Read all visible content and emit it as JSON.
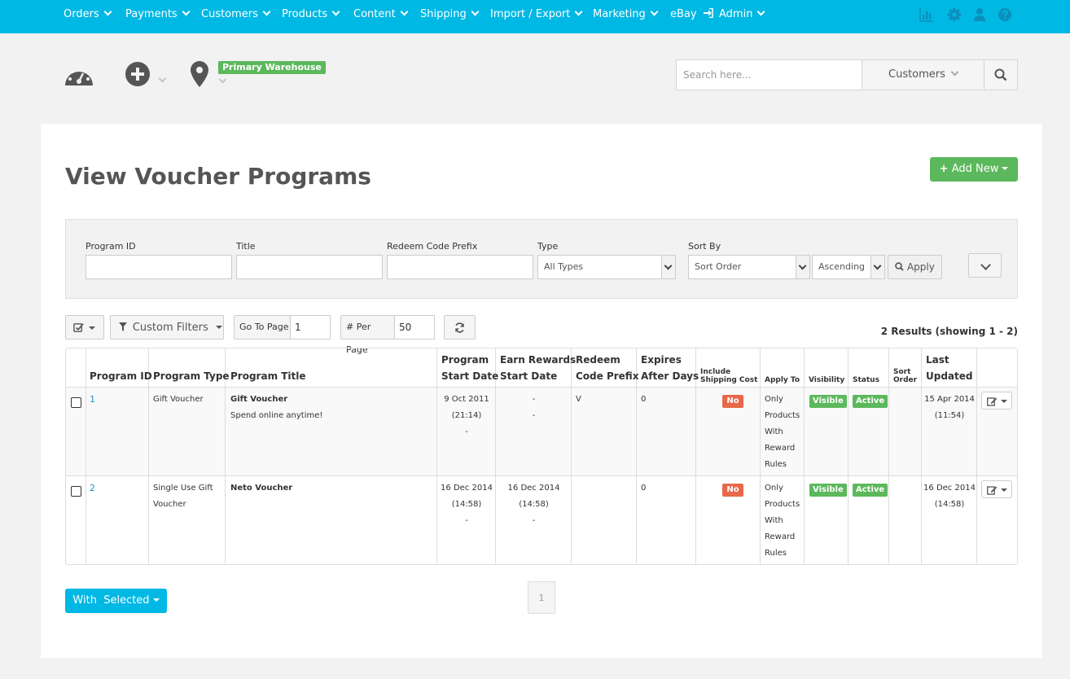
{
  "nav": {
    "items": [
      "Orders",
      "Payments",
      "Customers",
      "Products",
      "Content",
      "Shipping",
      "Import / Export",
      "Marketing",
      "eBay",
      "Admin"
    ],
    "right_icons": [
      "reports-icon",
      "settings-gear-icon",
      "user-icon",
      "help-icon"
    ]
  },
  "toolbar": {
    "warehouse_badge": "Primary Warehouse",
    "search_placeholder": "Search here...",
    "search_scope": "Customers"
  },
  "page": {
    "title": "View Voucher Programs",
    "add_new_label": "Add New"
  },
  "filters": {
    "program_id_label": "Program ID",
    "title_label": "Title",
    "redeem_code_prefix_label": "Redeem Code Prefix",
    "type_label": "Type",
    "type_value": "All Types",
    "sort_by_label": "Sort By",
    "sort_by_value": "Sort Order",
    "sort_dir_value": "Ascending",
    "apply_label": "Apply"
  },
  "list_controls": {
    "custom_filters_label": "Custom Filters",
    "go_to_page_label": "Go To Page",
    "go_to_page_value": "1",
    "per_page_label": "# Per Page",
    "per_page_value": "50",
    "results_text": "2 Results (showing 1 - 2)"
  },
  "table": {
    "headers": {
      "program_id": "Program ID",
      "program_type": "Program Type",
      "program_title": "Program Title",
      "program_start_1": "Program",
      "program_start_2": "Start Date",
      "earn_1": "Earn Rewards",
      "earn_2": "Start Date",
      "redeem_1": "Redeem",
      "redeem_2": "Code Prefix",
      "expires_1": "Expires",
      "expires_2": "After Days",
      "shipping_1": "Include",
      "shipping_2": "Shipping Cost",
      "apply_to": "Apply To",
      "visibility": "Visibility",
      "status": "Status",
      "sort_1": "Sort",
      "sort_2": "Order",
      "updated_1": "Last",
      "updated_2": "Updated"
    },
    "rows": [
      {
        "id": "1",
        "type": "Gift Voucher",
        "type_2": "",
        "title": "Gift Voucher",
        "subtitle": "Spend online anytime!",
        "start_date": "9 Oct 2011",
        "start_time": "(21:14)",
        "start_extra": "-",
        "earn_date": "-",
        "earn_time": "-",
        "earn_extra": "",
        "prefix": "V",
        "expires": "0",
        "shipping": "No",
        "apply_to": [
          "Only",
          "Products",
          "With",
          "Reward",
          "Rules"
        ],
        "visibility": "Visible",
        "status": "Active",
        "sort_order": "",
        "updated_date": "15 Apr 2014",
        "updated_time": "(11:54)"
      },
      {
        "id": "2",
        "type": "Single Use Gift",
        "type_2": "Voucher",
        "title": "Neto Voucher",
        "subtitle": "",
        "start_date": "16 Dec 2014",
        "start_time": "(14:58)",
        "start_extra": "-",
        "earn_date": "16 Dec 2014",
        "earn_time": "(14:58)",
        "earn_extra": "-",
        "prefix": "",
        "expires": "0",
        "shipping": "No",
        "apply_to": [
          "Only",
          "Products",
          "With",
          "Reward",
          "Rules"
        ],
        "visibility": "Visible",
        "status": "Active",
        "sort_order": "",
        "updated_date": "16 Dec 2014",
        "updated_time": "(14:58)"
      }
    ]
  },
  "footer": {
    "with_selected_label": "With  Selected",
    "current_page": "1"
  },
  "colors": {
    "nav_bg": "#00b8e4",
    "success": "#5cb85c",
    "danger": "#e8684a",
    "link": "#1d8fcf"
  }
}
